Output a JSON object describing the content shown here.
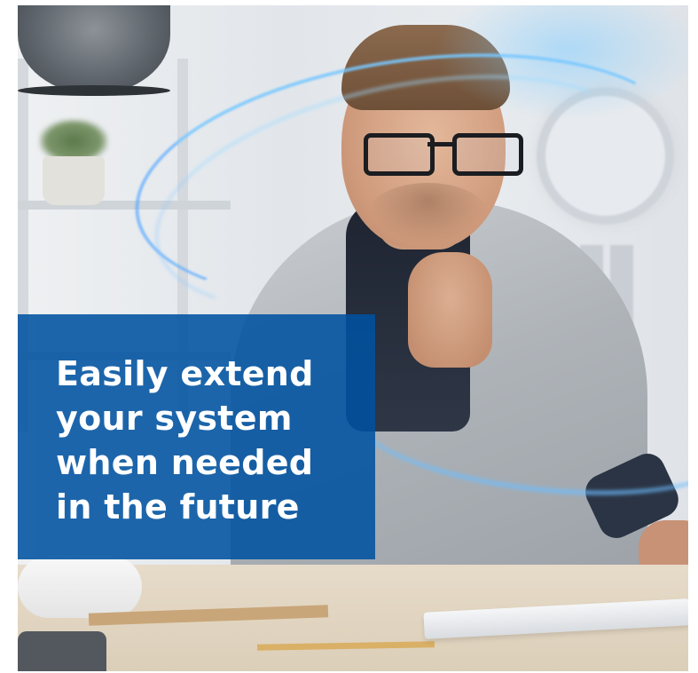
{
  "headline": {
    "lines": [
      "Easily extend",
      "your system",
      "when needed",
      "in the future"
    ]
  },
  "colors": {
    "overlay": "#0052a0",
    "text": "#ffffff",
    "accent_light": "#78c8ff"
  }
}
